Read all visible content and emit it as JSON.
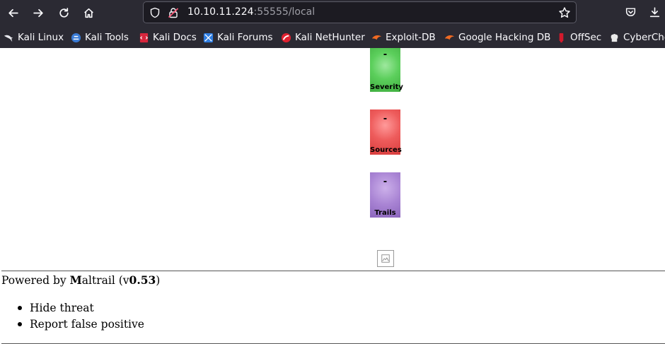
{
  "browser": {
    "url_host": "10.10.11.224",
    "url_rest": ":55555/local",
    "bookmarks": [
      {
        "label": "Kali Linux",
        "icon": "kali-dragon-icon"
      },
      {
        "label": "Kali Tools",
        "icon": "kali-tools-icon"
      },
      {
        "label": "Kali Docs",
        "icon": "kali-docs-icon"
      },
      {
        "label": "Kali Forums",
        "icon": "kali-forums-icon"
      },
      {
        "label": "Kali NetHunter",
        "icon": "nethunter-icon"
      },
      {
        "label": "Exploit-DB",
        "icon": "exploit-db-icon"
      },
      {
        "label": "Google Hacking DB",
        "icon": "ghdb-icon"
      },
      {
        "label": "OffSec",
        "icon": "offsec-icon"
      },
      {
        "label": "CyberChe",
        "icon": "cyberchef-icon"
      }
    ]
  },
  "tiles": [
    {
      "value": "-",
      "label": "Severity",
      "color": "#5ccf5c"
    },
    {
      "value": "-",
      "label": "Sources",
      "color": "#ee5c5c"
    },
    {
      "value": "-",
      "label": "Trails",
      "color": "#a984d4"
    }
  ],
  "footer": {
    "powered_prefix": "Powered by ",
    "brand_initial": "M",
    "brand_rest": "altrail",
    "version_prefix": " (v",
    "version": "0.53",
    "version_suffix": ")"
  },
  "menu": {
    "items": [
      "Hide threat",
      "Report false positive"
    ]
  }
}
